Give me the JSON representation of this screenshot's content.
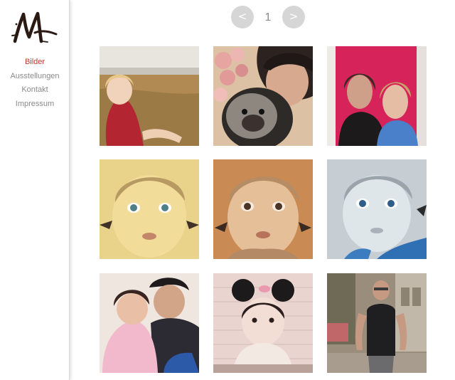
{
  "site": {
    "logo_letter": "M",
    "nav": [
      "Bilder",
      "Ausstellungen",
      "Kontakt",
      "Impressum"
    ],
    "active_index": 0,
    "accent_color": "#c0392b"
  },
  "pager": {
    "prev_label": "<",
    "page_number": "1",
    "next_label": ">"
  },
  "gallery": [
    "painting-woman-on-beach",
    "painting-girl-with-dog-and-roses",
    "painting-two-women-pink-background",
    "painting-toddler-yellow",
    "painting-toddler-sepia",
    "painting-toddler-blue",
    "painting-two-children-hugging",
    "painting-girl-mouse-ears",
    "painting-man-tank-top-street"
  ]
}
